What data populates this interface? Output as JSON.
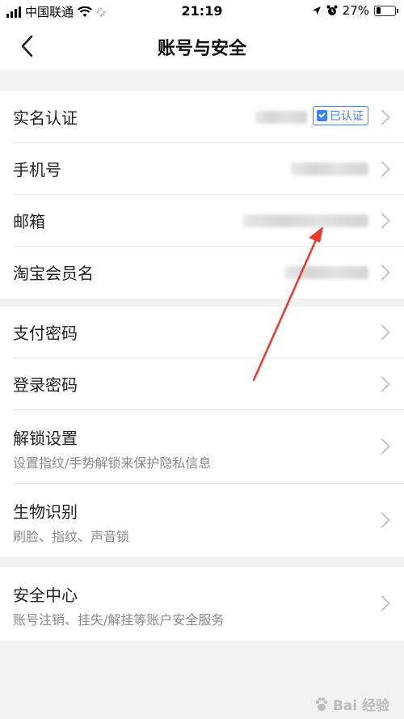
{
  "status_bar": {
    "carrier": "中国联通",
    "time": "21:19",
    "battery_percent": "27%",
    "battery_level": 0.27,
    "icons": [
      "signal-icon",
      "wifi-icon",
      "loading-icon",
      "location-icon",
      "alarm-icon",
      "battery-icon"
    ]
  },
  "nav": {
    "title": "账号与安全",
    "back_icon": "chevron-left-icon"
  },
  "groups": [
    {
      "rows": [
        {
          "title": "实名认证",
          "value_hidden": true,
          "badge": "已认证"
        },
        {
          "title": "手机号",
          "value_hidden": true
        },
        {
          "title": "邮箱",
          "value_hidden": true
        },
        {
          "title": "淘宝会员名",
          "value_hidden": true
        }
      ]
    },
    {
      "rows": [
        {
          "title": "支付密码"
        },
        {
          "title": "登录密码"
        },
        {
          "title": "解锁设置",
          "subtitle": "设置指纹/手势解锁来保护隐私信息"
        },
        {
          "title": "生物识别",
          "subtitle": "刷脸、指纹、声音锁"
        }
      ]
    },
    {
      "rows": [
        {
          "title": "安全中心",
          "subtitle": "账号注销、挂失/解挂等账户安全服务"
        }
      ]
    }
  ],
  "annotation": {
    "color": "#e8392c"
  },
  "watermark": {
    "text": "Bai 经验"
  },
  "colors": {
    "badge": "#3c82f0",
    "background": "#f2f2f2"
  }
}
